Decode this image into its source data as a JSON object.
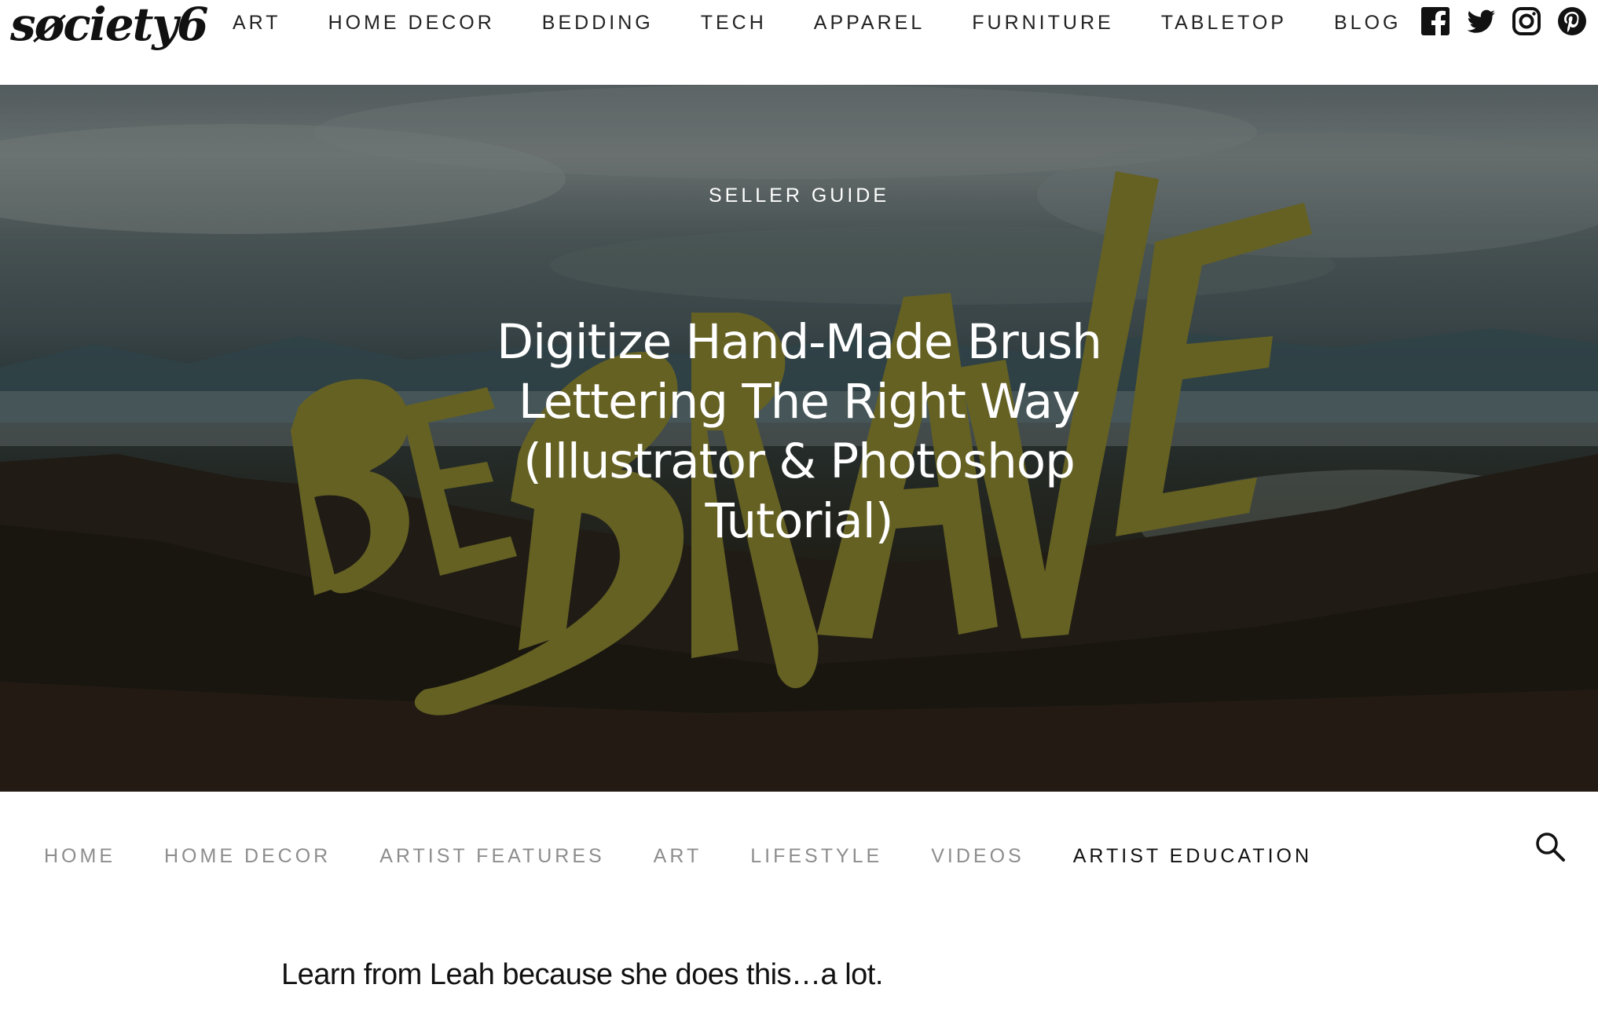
{
  "brand": {
    "logo_text": "søciety6"
  },
  "top_nav": {
    "items": [
      {
        "label": "ART"
      },
      {
        "label": "HOME DECOR"
      },
      {
        "label": "BEDDING"
      },
      {
        "label": "TECH"
      },
      {
        "label": "APPAREL"
      },
      {
        "label": "FURNITURE"
      },
      {
        "label": "TABLETOP"
      },
      {
        "label": "BLOG"
      }
    ]
  },
  "social": {
    "icons": [
      "facebook-icon",
      "twitter-icon",
      "instagram-icon",
      "pinterest-icon"
    ]
  },
  "hero": {
    "category": "SELLER GUIDE",
    "title": "Digitize Hand-Made Brush Lettering The Right Way (Illustrator & Photoshop Tutorial)",
    "artwork_lettering": "BE BRAVE",
    "lettering_color": "#6e6a26"
  },
  "blog_nav": {
    "items": [
      {
        "label": "HOME"
      },
      {
        "label": "HOME DECOR"
      },
      {
        "label": "ARTIST FEATURES"
      },
      {
        "label": "ART"
      },
      {
        "label": "LIFESTYLE"
      },
      {
        "label": "VIDEOS"
      },
      {
        "label": "ARTIST EDUCATION"
      }
    ],
    "active": "ARTIST EDUCATION",
    "search_icon": "search-icon"
  },
  "article": {
    "lead": "Learn from Leah because she does this…a lot."
  }
}
